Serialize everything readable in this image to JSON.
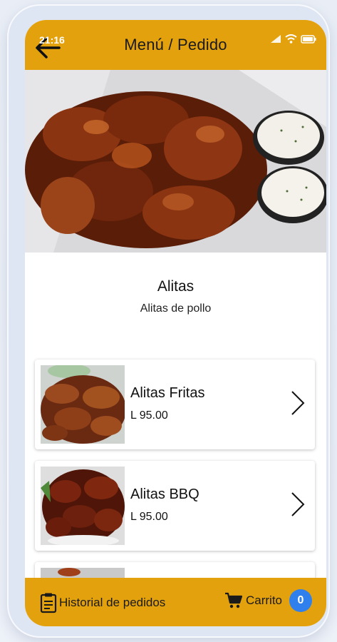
{
  "status_bar": {
    "time": "21:16"
  },
  "header": {
    "title": "Menú / Pedido"
  },
  "category": {
    "title": "Alitas",
    "subtitle": "Alitas de pollo"
  },
  "products": [
    {
      "name": "Alitas Fritas",
      "price": "L 95.00"
    },
    {
      "name": "Alitas BBQ",
      "price": "L 95.00"
    }
  ],
  "footer": {
    "history_label": "Historial de pedidos",
    "cart_label": "Carrito",
    "cart_count": "0"
  },
  "colors": {
    "accent": "#e3a10e",
    "badge": "#2f80ed"
  }
}
